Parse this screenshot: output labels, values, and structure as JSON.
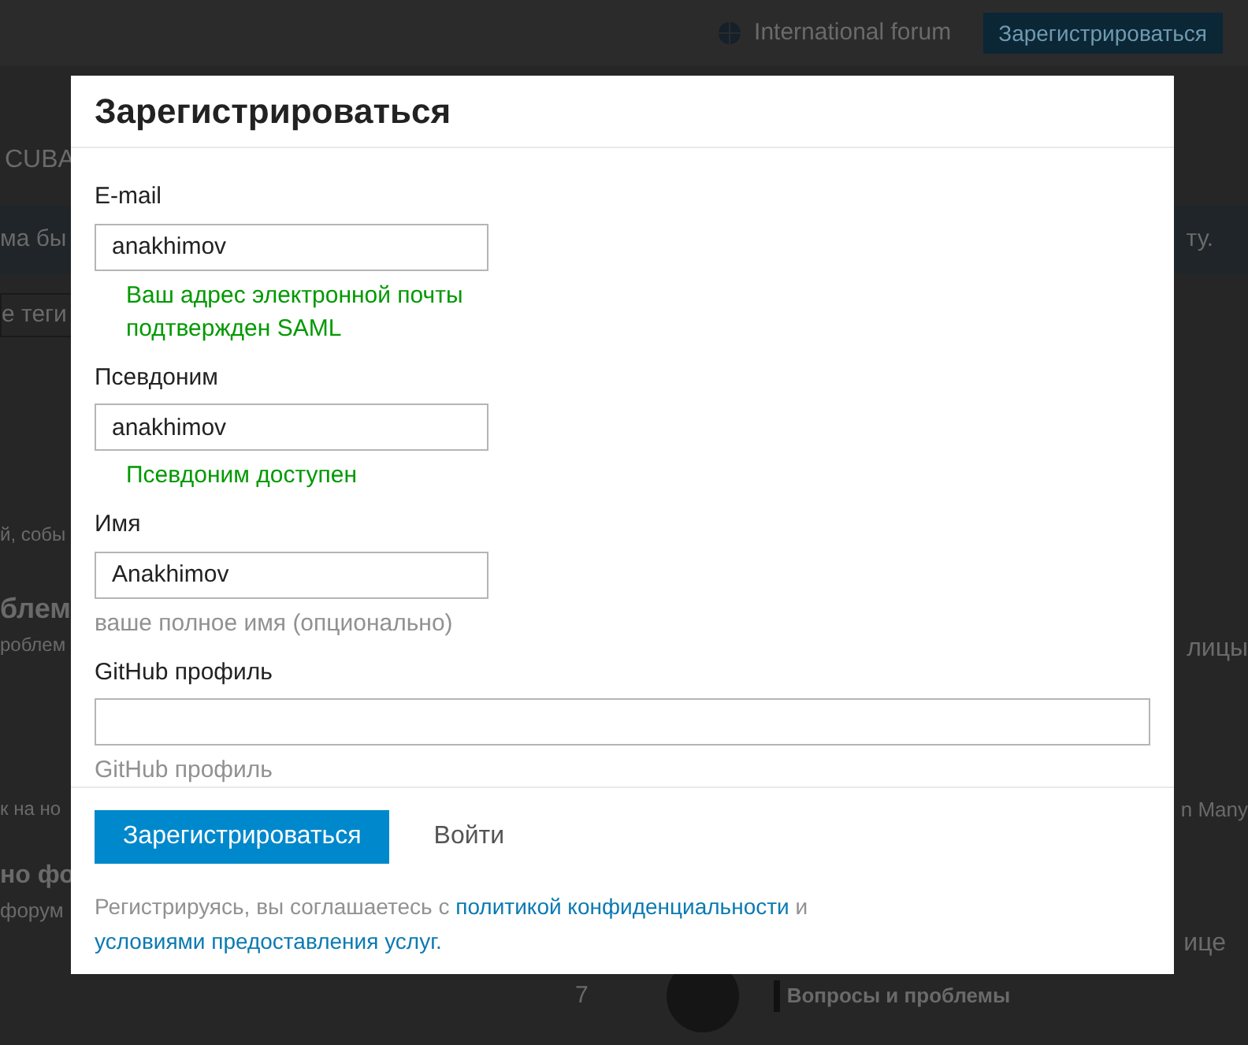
{
  "background_page": {
    "header": {
      "forum_link": "International forum",
      "signup_button": "Зарегистрироваться"
    },
    "fragments_left": [
      "CUBA",
      "ма бы",
      "е теги",
      "й, собы",
      "блем",
      "роблем",
      "к на но",
      "но фо",
      "форум"
    ],
    "fragments_right": [
      "ту.",
      "лицы",
      "n Many",
      "ице"
    ],
    "topic": {
      "count": "7",
      "category": "Вопросы и проблемы"
    }
  },
  "modal": {
    "title": "Зарегистрироваться",
    "fields": [
      {
        "label": "E-mail",
        "value": "anakhimov",
        "note": "Ваш адрес электронной почты подтвержден SAML",
        "kind": "success",
        "wide": false
      },
      {
        "label": "Псевдоним",
        "value": "anakhimov",
        "note": "Псевдоним доступен",
        "kind": "success",
        "wide": false
      },
      {
        "label": "Имя",
        "value": "Anakhimov",
        "note": "ваше полное имя (опционально)",
        "kind": "hint",
        "wide": false
      },
      {
        "label": "GitHub профиль",
        "note": "GitHub профиль",
        "kind": "hint",
        "wide": true
      }
    ],
    "primary_button": "Зарегистрироваться",
    "secondary_button": "Войти",
    "legal": {
      "prefix": "Регистрируясь, вы соглашаетесь с",
      "privacy_link": "политикой конфиденциальности",
      "joiner": "и",
      "terms_link": "условиями предоставления услуг."
    }
  }
}
